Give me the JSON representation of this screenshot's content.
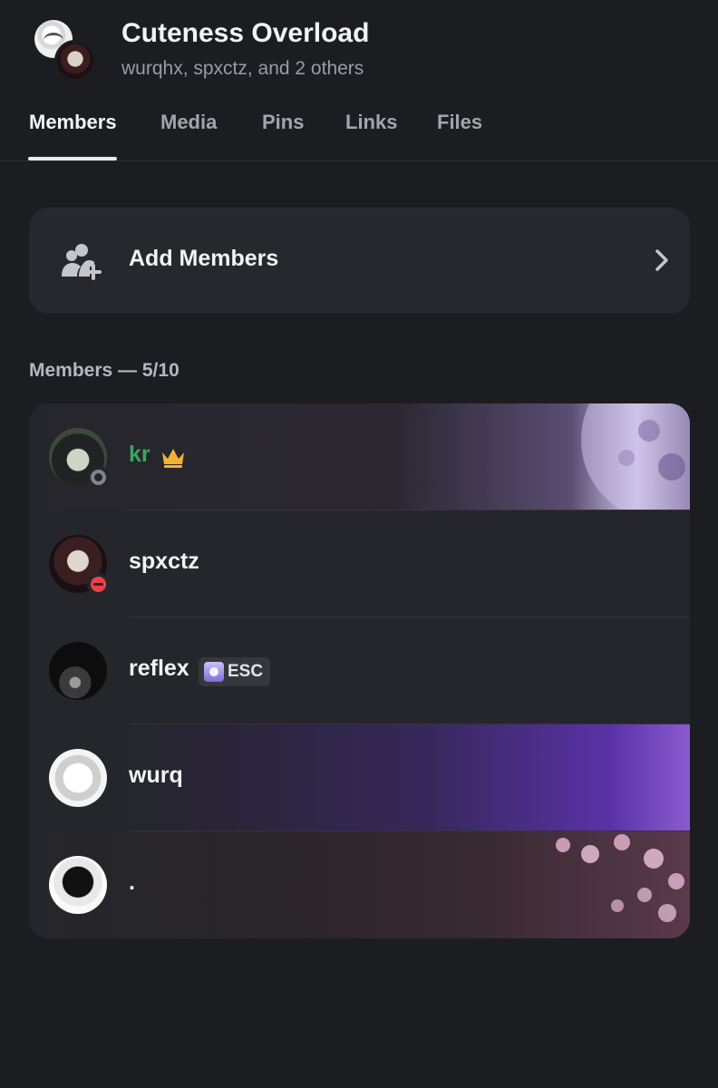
{
  "group": {
    "title": "Cuteness Overload",
    "subtitle": "wurqhx, spxctz, and 2 others"
  },
  "tabs": [
    {
      "label": "Members",
      "active": true
    },
    {
      "label": "Media",
      "active": false
    },
    {
      "label": "Pins",
      "active": false
    },
    {
      "label": "Links",
      "active": false
    },
    {
      "label": "Files",
      "active": false
    }
  ],
  "add_members": {
    "label": "Add Members",
    "icon": "add-user-icon",
    "chevron": "chevron-right-icon"
  },
  "members_section": {
    "label": "Members — 5/10"
  },
  "members": [
    {
      "name": "kr",
      "name_color": "#3ba55c",
      "status": "idle-offline",
      "status_color": "#80848e",
      "owner_badge": "crown-icon"
    },
    {
      "name": "spxctz",
      "name_color": "#f2f3f5",
      "status": "dnd",
      "status_color": "#ed4245"
    },
    {
      "name": "reflex",
      "name_color": "#f2f3f5",
      "status": "none",
      "tag": "ESC"
    },
    {
      "name": "wurq",
      "name_color": "#f2f3f5",
      "status": "none"
    },
    {
      "name": ".",
      "name_color": "#f2f3f5",
      "status": "none"
    }
  ],
  "colors": {
    "background": "#1c1d21",
    "card": "#27282e",
    "crown": "#f0b232"
  }
}
